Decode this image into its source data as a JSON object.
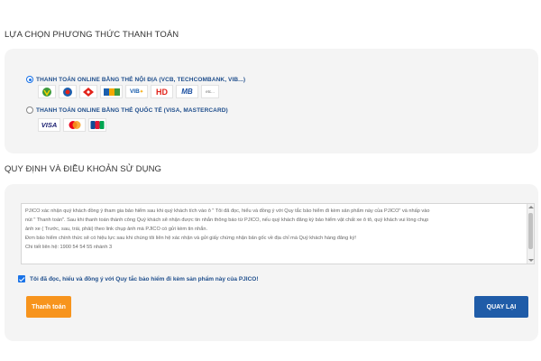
{
  "payment_section": {
    "title": "LỰA CHỌN PHƯƠNG THỨC THANH TOÁN",
    "domestic": {
      "label": "THANH TOÁN ONLINE BẰNG THẺ NỘI ĐỊA (VCB, TECHCOMBANK, VIB...)",
      "selected": true,
      "logos": [
        "VCB",
        "VietinBank",
        "Techcombank",
        "Eximbank",
        "VIB",
        "HD",
        "MB",
        "etc..."
      ]
    },
    "international": {
      "label": "THANH TOÁN ONLINE BẰNG THẺ QUỐC TẾ (VISA, MASTERCARD)",
      "selected": false,
      "logos": [
        "VISA",
        "MasterCard",
        "JCB"
      ]
    }
  },
  "terms_section": {
    "title": "QUY ĐỊNH VÀ ĐIỀU KHOẢN SỬ DỤNG",
    "text_lines": [
      "PJICO xác nhận quý khách đồng ý tham gia bảo hiểm sau khi quý khách tích vào ô \" Tôi đã đọc, hiểu và đồng ý với Quy tắc bảo hiểm đi kèm sản phẩm này của PJICO\" và nhấp vào",
      "nút \" Thanh toán\". Sau khi thanh toán thành công Quý khách sẽ nhận được tin nhắn thông báo từ PJICO, nếu quý khách đăng ký bảo hiểm vật chất xe ô tô, quý khách vui lòng chụp",
      "ảnh xe ( Trước, sau, trái, phải) theo link chụp ảnh mà PJICO có gửi kèm tin nhắn.",
      "Đơn bảo hiểm chính thức sẽ có hiệu lực sau khi chúng tôi liên hệ xác nhận và gửi giấy chứng nhận bản gốc về địa chỉ mà Quý khách hàng đăng ký!",
      "Chi tiết liên hệ: 1900 54 54 55 nhánh 3"
    ],
    "agree_label": "Tôi đã đọc, hiểu và đồng ý với Quy tắc bảo hiểm đi kèm sản phẩm này của PJICO!",
    "agree_checked": true
  },
  "buttons": {
    "pay": "Thanh toán",
    "back": "QUAY LẠI"
  },
  "colors": {
    "accent_blue": "#1f4e8c",
    "pay_orange": "#f7941d",
    "back_blue": "#1f5ca8",
    "panel_bg": "#f4f4f4"
  }
}
